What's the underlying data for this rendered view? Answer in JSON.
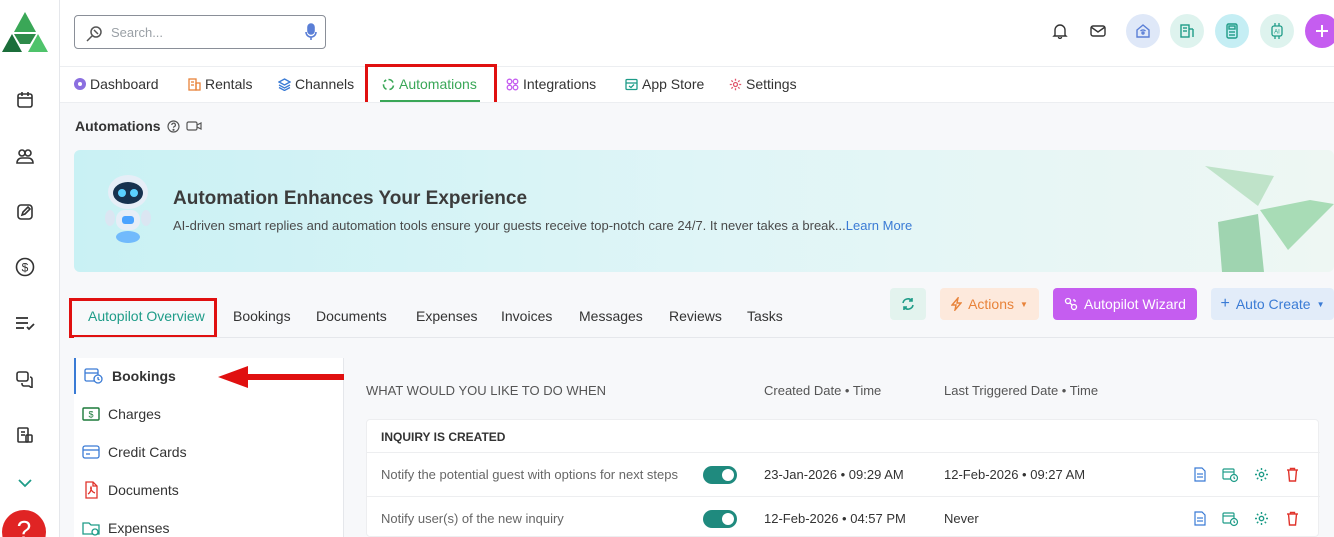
{
  "search": {
    "placeholder": "Search..."
  },
  "nav": {
    "items": [
      {
        "label": "Dashboard",
        "icon": "dashboard-icon"
      },
      {
        "label": "Rentals",
        "icon": "building-icon"
      },
      {
        "label": "Channels",
        "icon": "layers-icon"
      },
      {
        "label": "Automations",
        "icon": "recycle-icon",
        "active": true
      },
      {
        "label": "Integrations",
        "icon": "puzzle-icon"
      },
      {
        "label": "App Store",
        "icon": "store-icon"
      },
      {
        "label": "Settings",
        "icon": "gear-icon"
      }
    ]
  },
  "page": {
    "title": "Automations"
  },
  "banner": {
    "title": "Automation Enhances Your Experience",
    "text": "AI-driven smart replies and automation tools ensure your guests receive top-notch care 24/7. It never takes a break...",
    "link": "Learn More"
  },
  "tabs": [
    "Autopilot Overview",
    "Bookings",
    "Documents",
    "Expenses",
    "Invoices",
    "Messages",
    "Reviews",
    "Tasks"
  ],
  "toolbar": {
    "actions": "Actions",
    "wizard": "Autopilot Wizard",
    "auto_create": "Auto Create"
  },
  "categories": [
    {
      "label": "Bookings",
      "icon": "calendar-clock-icon"
    },
    {
      "label": "Charges",
      "icon": "dollar-bill-icon"
    },
    {
      "label": "Credit Cards",
      "icon": "credit-card-icon"
    },
    {
      "label": "Documents",
      "icon": "pdf-icon"
    },
    {
      "label": "Expenses",
      "icon": "folder-clock-icon"
    }
  ],
  "table": {
    "headers": {
      "what": "WHAT WOULD YOU LIKE TO DO WHEN",
      "created": "Created Date • Time",
      "triggered": "Last Triggered Date • Time"
    },
    "group": "INQUIRY IS CREATED",
    "rows": [
      {
        "desc": "Notify the potential guest with options for next steps",
        "enabled": true,
        "created": "23-Jan-2026 • 09:29 AM",
        "triggered": "12-Feb-2026 • 09:27 AM"
      },
      {
        "desc": "Notify user(s) of the new inquiry",
        "enabled": true,
        "created": "12-Feb-2026 • 04:57 PM",
        "triggered": "Never"
      }
    ]
  },
  "colors": {
    "accent_green": "#3aa757",
    "teal": "#1e9c88",
    "purple": "#c55df0",
    "highlight_red": "#e01010"
  }
}
